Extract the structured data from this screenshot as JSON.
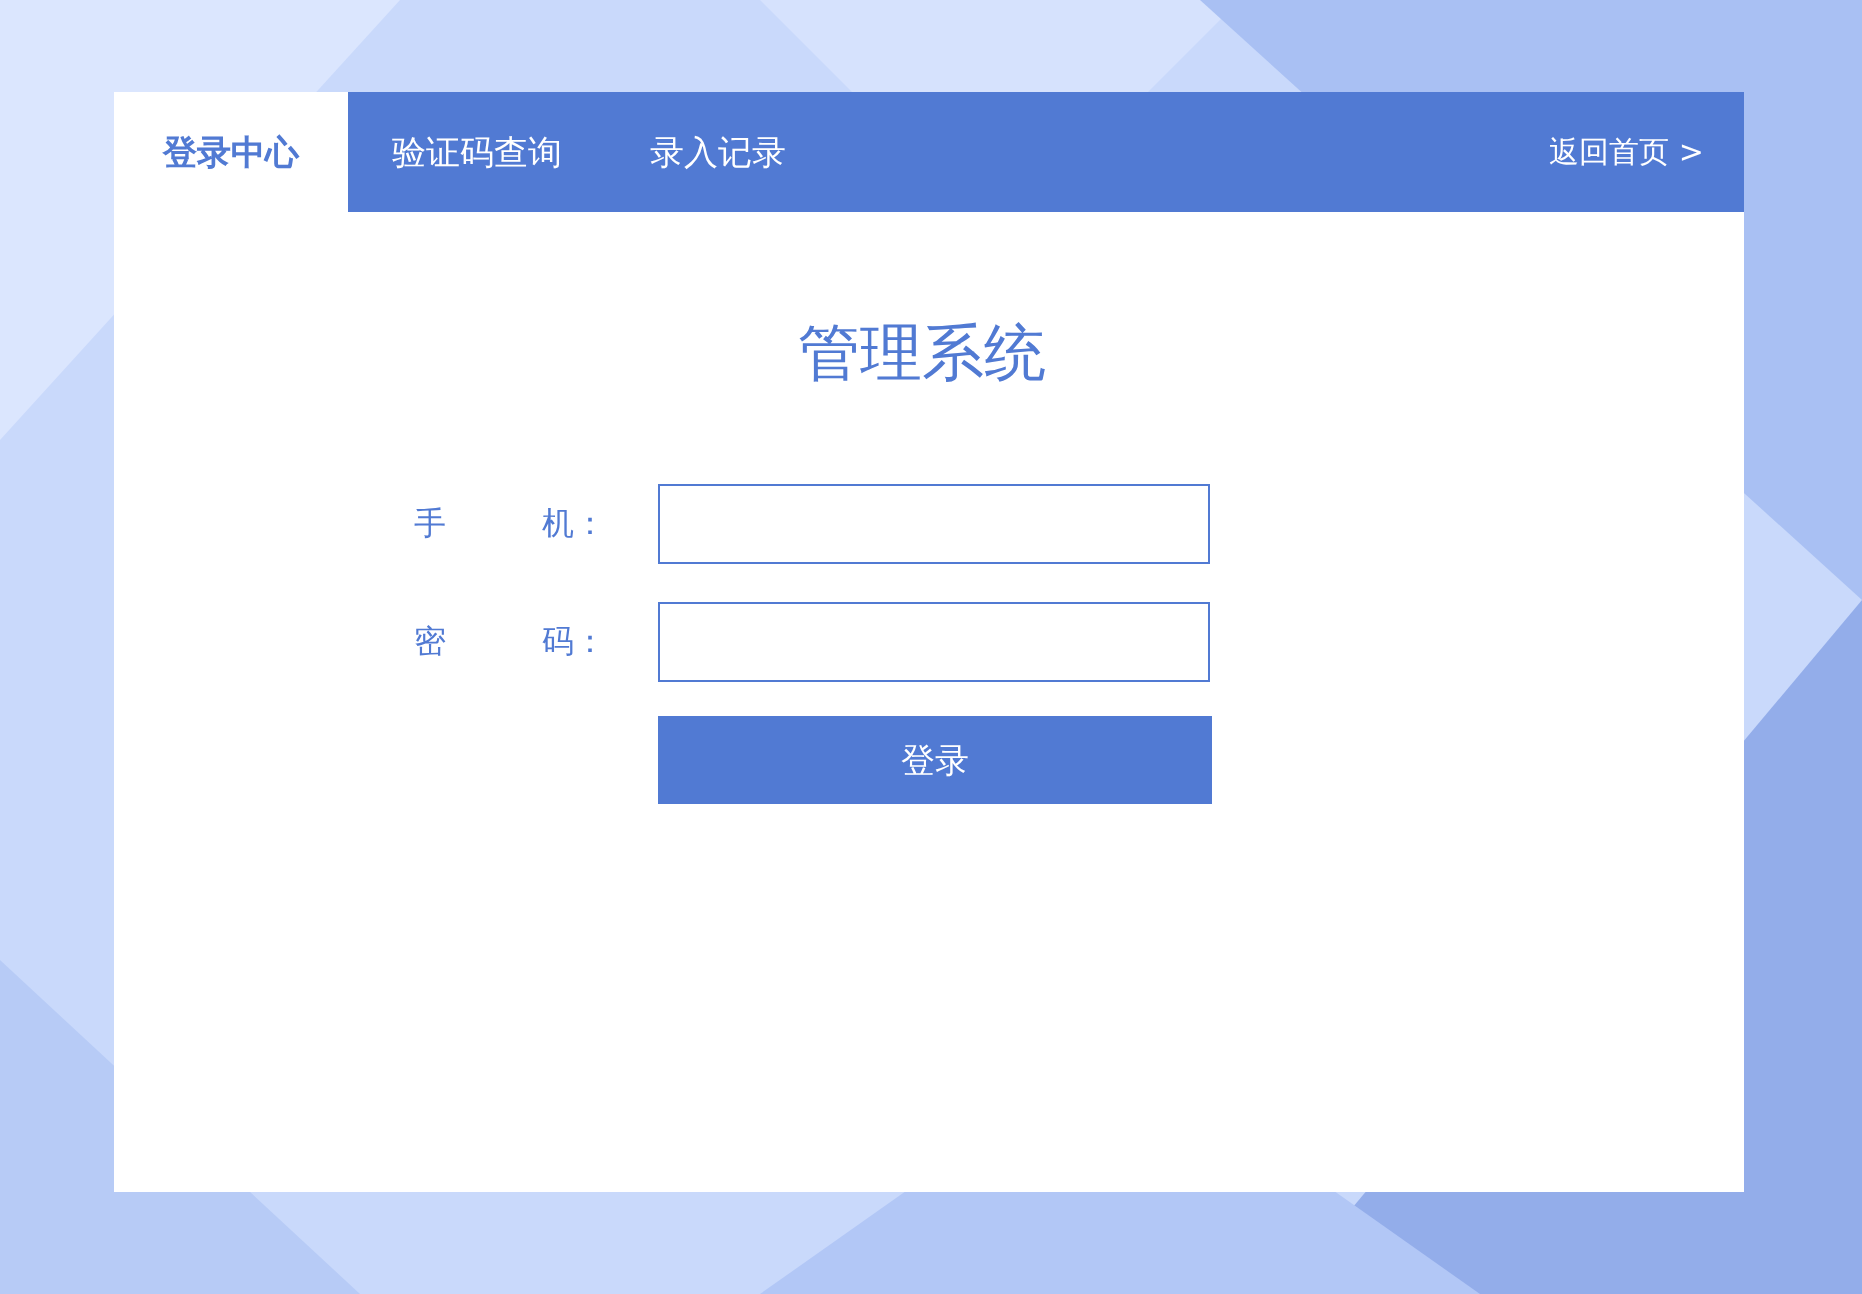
{
  "tabs": [
    {
      "label": "登录中心",
      "selected": true
    },
    {
      "label": "验证码查询",
      "selected": false
    },
    {
      "label": "录入记录",
      "selected": false
    }
  ],
  "home_link": "返回首页 >",
  "title": "管理系统",
  "fields": [
    {
      "label": "手　　　机："
    },
    {
      "label": "密　　　码："
    }
  ],
  "submit": "登录"
}
